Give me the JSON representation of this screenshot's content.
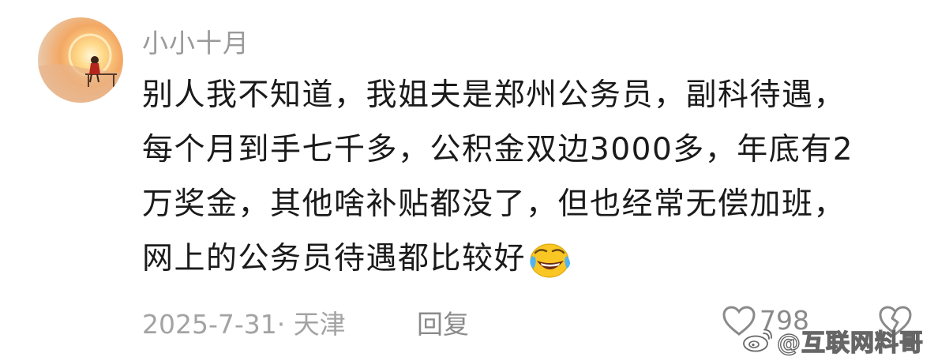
{
  "comment": {
    "username": "小小十月",
    "content_lines": [
      "别人我不知道，我姐夫是郑州公务员，副科待遇，",
      "每个月到手七千多，公积金双边3000多，年底有2",
      "万奖金，其他啥补贴都没了，但也经常无偿加班，",
      "网上的公务员待遇都比较好"
    ],
    "emoji": "laughing-crying-emoji",
    "meta": "2025-7-31· 天津",
    "reply_label": "回复",
    "like_icon": "heart-outline-icon",
    "like_count": "798",
    "dislike_icon": "broken-heart-outline-icon"
  },
  "watermark": {
    "text": "@互联网料哥"
  },
  "colors": {
    "text_primary": "#1a1a1a",
    "text_secondary": "#9a9a9a",
    "background": "#ffffff",
    "emoji_yellow": "#f9c623"
  }
}
